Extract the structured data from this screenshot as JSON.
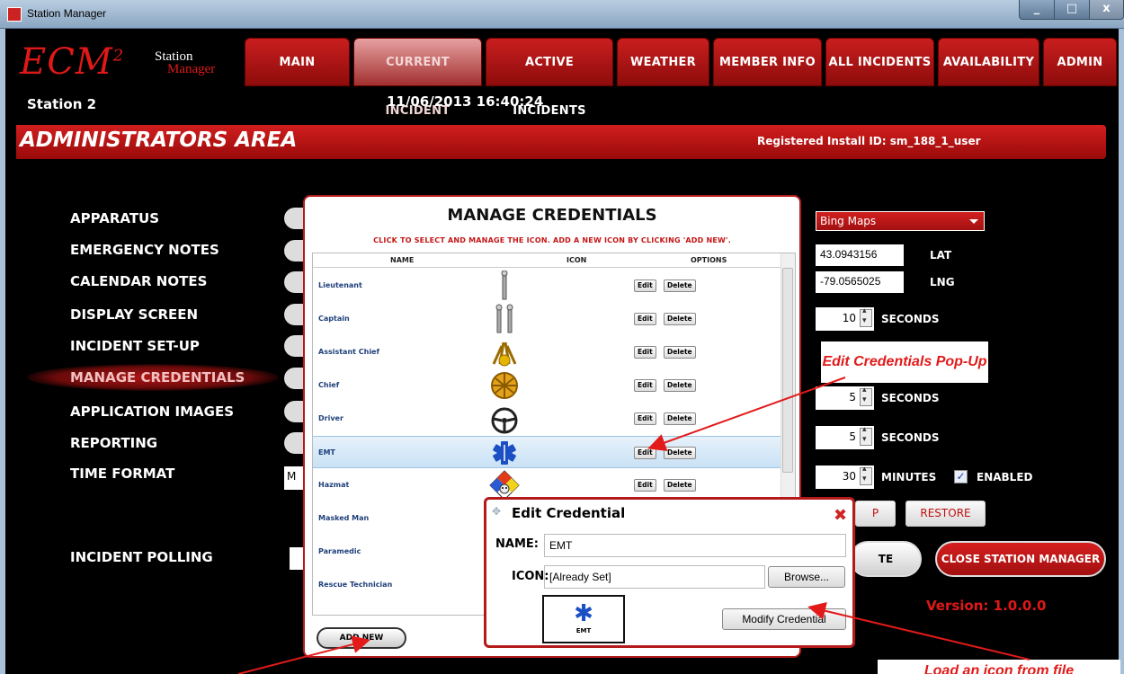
{
  "window": {
    "title": "Station Manager",
    "min": "_",
    "max": "□",
    "close": "x"
  },
  "logo": {
    "main": "ECM",
    "sup": "2",
    "sub1": "Station",
    "sub2": "Manager"
  },
  "nav": [
    "MAIN",
    "CURRENT INCIDENT",
    "ACTIVE INCIDENTS",
    "WEATHER",
    "MEMBER INFO",
    "ALL INCIDENTS",
    "AVAILABILITY",
    "ADMIN"
  ],
  "header": {
    "station": "Station 2",
    "datetime": "11/06/2013 16:40:24"
  },
  "admin_bar": {
    "title": "ADMINISTRATORS AREA",
    "install_id": "Registered Install ID: sm_188_1_user"
  },
  "menu": [
    "APPARATUS",
    "EMERGENCY NOTES",
    "CALENDAR NOTES",
    "DISPLAY SCREEN",
    "INCIDENT SET-UP",
    "MANAGE CREDENTIALS",
    "APPLICATION IMAGES",
    "REPORTING",
    "TIME FORMAT"
  ],
  "menu_selected": "MANAGE CREDENTIALS",
  "incident_polling": "INCIDENT POLLING",
  "time_format_value": "M",
  "settings": {
    "map_provider": "Bing Maps",
    "lat": "43.0943156",
    "lat_label": "LAT",
    "lng": "-79.0565025",
    "lng_label": "LNG",
    "spin1": "10",
    "spin1_label": "SECONDS",
    "spin2": "5",
    "spin2_label": "SECONDS",
    "spin3": "5",
    "spin3_label": "SECONDS",
    "spin4": "30",
    "spin4_label": "MINUTES",
    "enabled_label": "ENABLED",
    "enabled": true,
    "backup_partial": "P",
    "restore": "RESTORE",
    "update_partial": "TE",
    "close_station_manager": "CLOSE STATION MANAGER",
    "version": "Version:  1.0.0.0"
  },
  "manage_credentials": {
    "title": "MANAGE CREDENTIALS",
    "subtitle": "CLICK TO SELECT AND MANAGE THE ICON.  ADD A NEW ICON BY CLICKING 'ADD NEW'.",
    "columns": [
      "NAME",
      "ICON",
      "OPTIONS"
    ],
    "rows": [
      {
        "name": "Lieutenant",
        "icon": "one-bar-icon"
      },
      {
        "name": "Captain",
        "icon": "two-bars-icon"
      },
      {
        "name": "Assistant Chief",
        "icon": "four-horns-icon"
      },
      {
        "name": "Chief",
        "icon": "five-horns-icon"
      },
      {
        "name": "Driver",
        "icon": "steering-wheel-icon"
      },
      {
        "name": "EMT",
        "icon": "star-of-life-icon",
        "selected": true
      },
      {
        "name": "Hazmat",
        "icon": "hazmat-skull-icon"
      },
      {
        "name": "Masked Man",
        "icon": ""
      },
      {
        "name": "Paramedic",
        "icon": ""
      },
      {
        "name": "Rescue Technician",
        "icon": ""
      }
    ],
    "edit_label": "Edit",
    "delete_label": "Delete",
    "add_new": "ADD NEW"
  },
  "edit_credential": {
    "title": "Edit Credential",
    "name_label": "NAME:",
    "name_value": "EMT",
    "icon_label": "ICON:",
    "icon_value": "[Already Set]",
    "browse": "Browse...",
    "preview_caption": "EMT",
    "modify": "Modify Credential"
  },
  "annotations": {
    "callout": "Edit Credentials Pop-Up",
    "bottom_note": "Load an icon from file"
  },
  "colors": {
    "brand_red": "#c91e1e",
    "annotation_red": "#e21a1a",
    "emt_blue": "#1b4fc4"
  }
}
